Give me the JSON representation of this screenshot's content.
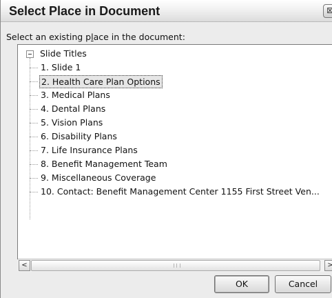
{
  "window": {
    "title": "Select Place in Document",
    "close_glyph": "⊠"
  },
  "prompt": {
    "before": "Select an existing p",
    "underlined": "l",
    "after": "ace in the document:"
  },
  "tree": {
    "root": "Slide Titles",
    "items": [
      "1. Slide 1",
      "2. Health Care Plan Options",
      "3. Medical Plans",
      "4. Dental Plans",
      "5. Vision Plans",
      "6. Disability Plans",
      "7. Life Insurance Plans",
      "8. Benefit Management Team",
      "9. Miscellaneous Coverage",
      "10. Contact:  Benefit Management Center 1155 First Street Ven..."
    ],
    "selected_index": 1
  },
  "scrollbar": {
    "left_glyph": "<",
    "right_glyph": ">"
  },
  "buttons": {
    "ok": "OK",
    "cancel": "Cancel"
  }
}
